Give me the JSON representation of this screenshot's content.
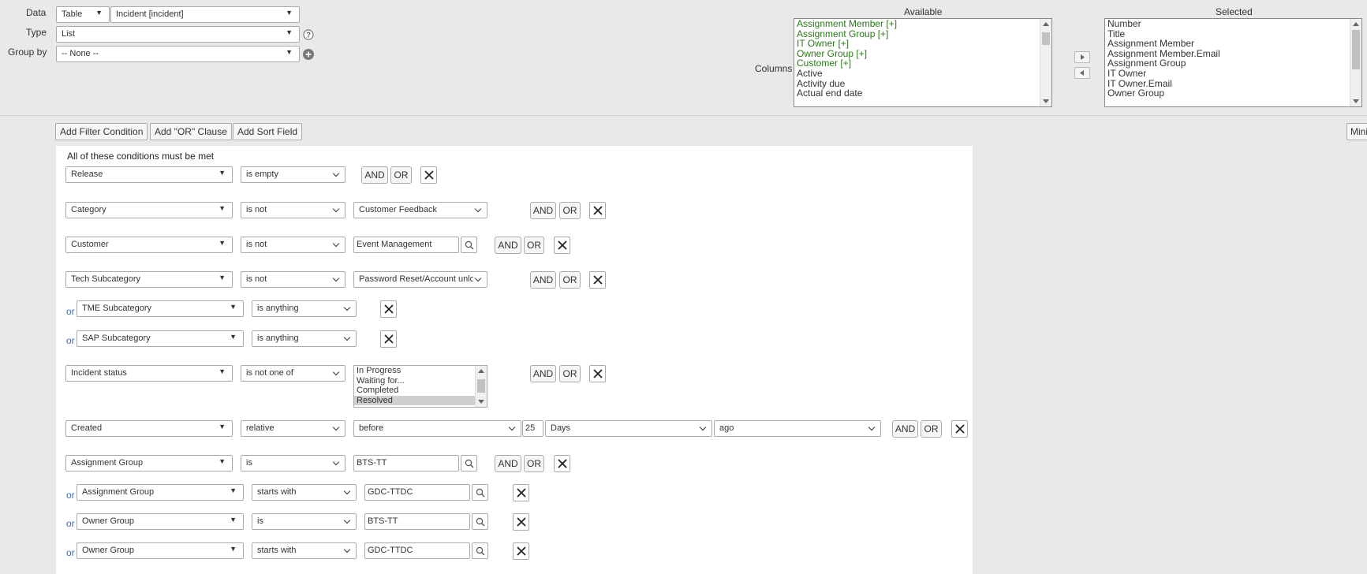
{
  "top": {
    "data_label": "Data",
    "data_source": "Table",
    "data_table": "Incident [incident]",
    "type_label": "Type",
    "type_value": "List",
    "groupby_label": "Group by",
    "groupby_value": "-- None --",
    "columns_label": "Columns",
    "available_label": "Available",
    "selected_label": "Selected",
    "available_items": [
      "Assignment Member [+]",
      "Assignment Group [+]",
      "IT Owner [+]",
      "Owner Group [+]",
      "Customer [+]",
      "Active",
      "Activity due",
      "Actual end date"
    ],
    "selected_items": [
      "Number",
      "Title",
      "Assignment Member",
      "Assignment Member.Email",
      "Assignment Group",
      "IT Owner",
      "IT Owner.Email",
      "Owner Group"
    ]
  },
  "toolbar": {
    "add_filter": "Add Filter Condition",
    "add_or": "Add \"OR\" Clause",
    "add_sort": "Add Sort Field",
    "mini": "Mini"
  },
  "filter": {
    "heading": "All of these conditions must be met",
    "and_label": "AND",
    "or_label": "OR",
    "or_prefix": "or",
    "conditions": [
      {
        "field": "Release",
        "operator": "is empty"
      },
      {
        "field": "Category",
        "operator": "is not",
        "value": "Customer Feedback"
      },
      {
        "field": "Customer",
        "operator": "is not",
        "value": "Event Management"
      },
      {
        "field": "Tech Subcategory",
        "operator": "is not",
        "value": "Password Reset/Account unlock"
      },
      {
        "field": "TME Subcategory",
        "operator": "is anything"
      },
      {
        "field": "SAP Subcategory",
        "operator": "is anything"
      },
      {
        "field": "Incident status",
        "operator": "is not one of",
        "values": [
          "In Progress",
          "Waiting for...",
          "Completed",
          "Resolved"
        ]
      },
      {
        "field": "Created",
        "operator": "relative",
        "value": "before",
        "number": "25",
        "unit": "Days",
        "direction": "ago"
      },
      {
        "field": "Assignment Group",
        "operator": "is",
        "value": "BTS-TT"
      },
      {
        "field": "Assignment Group",
        "operator": "starts with",
        "value": "GDC-TTDC"
      },
      {
        "field": "Owner Group",
        "operator": "is",
        "value": "BTS-TT"
      },
      {
        "field": "Owner Group",
        "operator": "starts with",
        "value": "GDC-TTDC"
      }
    ]
  },
  "icons": {
    "help": "question-circle-icon",
    "add": "plus-circle-icon",
    "search": "magnifier-icon",
    "delete": "close-icon",
    "move_right": "arrow-right-icon",
    "move_left": "arrow-left-icon"
  }
}
